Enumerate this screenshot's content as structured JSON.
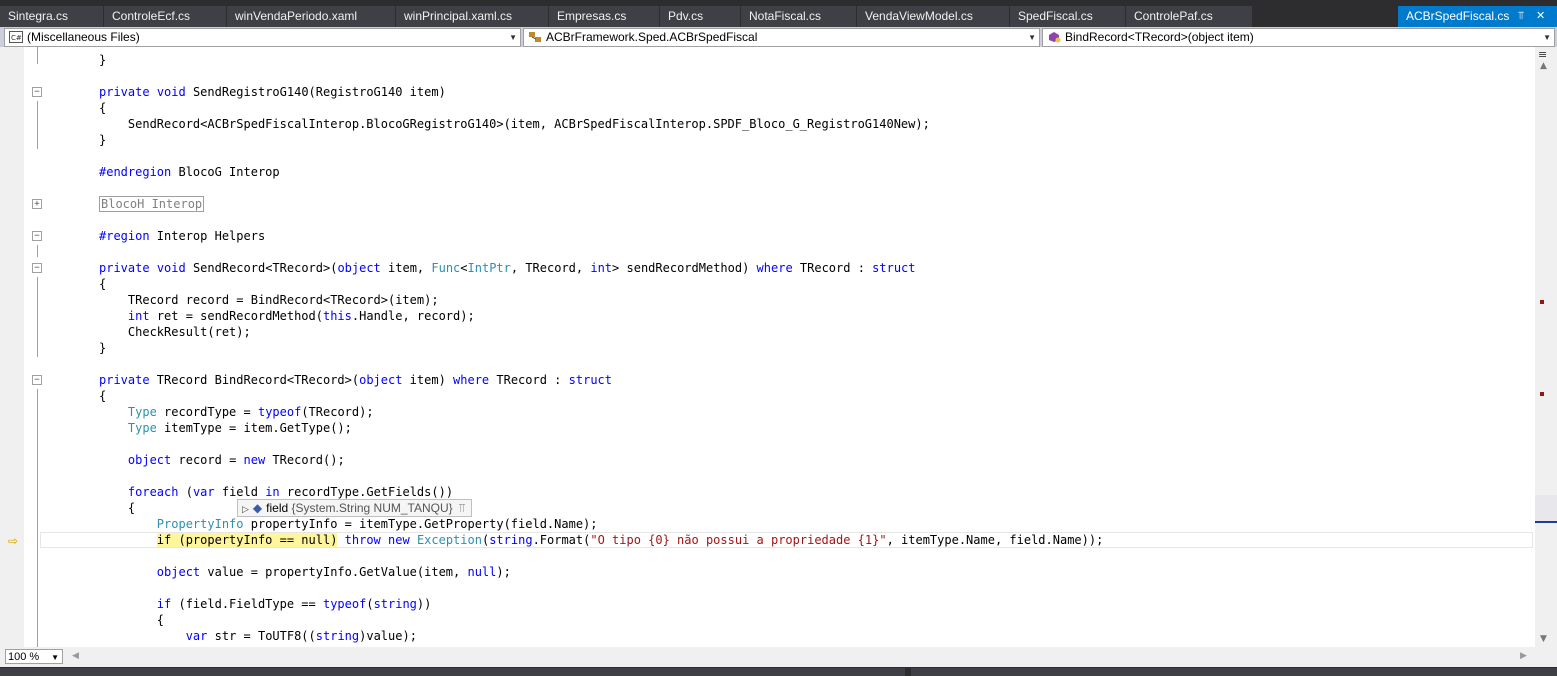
{
  "tabs": [
    {
      "label": "Sintegra.cs"
    },
    {
      "label": "ControleEcf.cs"
    },
    {
      "label": "winVendaPeriodo.xaml"
    },
    {
      "label": "winPrincipal.xaml.cs"
    },
    {
      "label": "Empresas.cs"
    },
    {
      "label": "Pdv.cs"
    },
    {
      "label": "NotaFiscal.cs"
    },
    {
      "label": "VendaViewModel.cs"
    },
    {
      "label": "SpedFiscal.cs"
    },
    {
      "label": "ControlePaf.cs"
    }
  ],
  "active_tab": {
    "label": "ACBrSpedFiscal.cs"
  },
  "navbar": {
    "project": "(Miscellaneous Files)",
    "type": "ACBrFramework.Sped.ACBrSpedFiscal",
    "member": "BindRecord<TRecord>(object item)"
  },
  "code": {
    "l01": "}",
    "l02a": "private",
    "l02b": " ",
    "l02c": "void",
    "l02d": " SendRegistroG140(RegistroG140 item)",
    "l03": "{",
    "l04": "    SendRecord<ACBrSpedFiscalInterop.BlocoGRegistroG140>(item, ACBrSpedFiscalInterop.SPDF_Bloco_G_RegistroG140New);",
    "l05": "}",
    "l06a": "#endregion",
    "l06b": " BlocoG Interop",
    "l07": "BlocoH Interop",
    "l08a": "#region",
    "l08b": " Interop Helpers",
    "l09a": "private",
    "l09b": " ",
    "l09c": "void",
    "l09d": " SendRecord<TRecord>(",
    "l09e": "object",
    "l09f": " item, ",
    "l09g": "Func",
    "l09h": "<",
    "l09i": "IntPtr",
    "l09j": ", TRecord, ",
    "l09k": "int",
    "l09l": "> sendRecordMethod) ",
    "l09m": "where",
    "l09n": " TRecord : ",
    "l09o": "struct",
    "l10": "{",
    "l11": "    TRecord record = BindRecord<TRecord>(item);",
    "l12a": "    ",
    "l12b": "int",
    "l12c": " ret = sendRecordMethod(",
    "l12d": "this",
    "l12e": ".Handle, record);",
    "l13": "    CheckResult(ret);",
    "l14": "}",
    "l15a": "private",
    "l15b": " TRecord BindRecord<TRecord>(",
    "l15c": "object",
    "l15d": " item) ",
    "l15e": "where",
    "l15f": " TRecord : ",
    "l15g": "struct",
    "l16": "{",
    "l17a": "    ",
    "l17b": "Type",
    "l17c": " recordType = ",
    "l17d": "typeof",
    "l17e": "(TRecord);",
    "l18a": "    ",
    "l18b": "Type",
    "l18c": " itemType = item.GetType();",
    "l19a": "    ",
    "l19b": "object",
    "l19c": " record = ",
    "l19d": "new",
    "l19e": " TRecord();",
    "l20a": "    ",
    "l20b": "foreach",
    "l20c": " (",
    "l20d": "var",
    "l20e": " field ",
    "l20f": "in",
    "l20g": " recordType.GetFields())",
    "l21": "    {",
    "l22a": "        ",
    "l22b": "PropertyInfo",
    "l22c": " propertyInfo = itemType.GetProperty(field.Name);",
    "l23a": "        ",
    "l23b": "if (propertyInfo == null)",
    "l23c": " ",
    "l23d": "throw",
    "l23e": " ",
    "l23f": "new",
    "l23g": " ",
    "l23h": "Exception",
    "l23i": "(",
    "l23j": "string",
    "l23k": ".Format(",
    "l23l": "\"O tipo {0} não possui a propriedade {1}\"",
    "l23m": ", itemType.Name, field.Name));",
    "l24a": "        ",
    "l24b": "object",
    "l24c": " value = propertyInfo.GetValue(item, ",
    "l24d": "null",
    "l24e": ");",
    "l25a": "        ",
    "l25b": "if",
    "l25c": " (field.FieldType == ",
    "l25d": "typeof",
    "l25e": "(",
    "l25f": "string",
    "l25g": "))",
    "l26": "        {",
    "l27a": "            ",
    "l27b": "var",
    "l27c": " str = ToUTF8((",
    "l27d": "string",
    "l27e": ")value);"
  },
  "datatip": {
    "name": "field",
    "value": "{System.String NUM_TANQU}"
  },
  "zoom": "100 %",
  "colors": {
    "keyword": "#0000ff",
    "type": "#2b91af",
    "string": "#a31515",
    "active_tab": "#007acc",
    "highlight": "#fff59d"
  }
}
